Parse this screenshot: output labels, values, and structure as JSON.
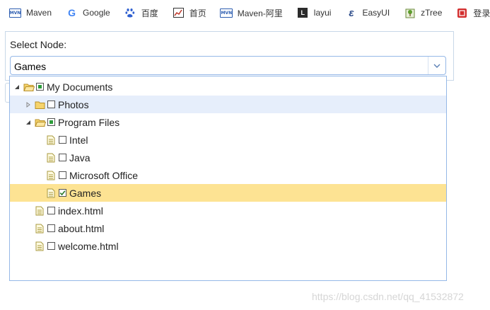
{
  "bookmarks": [
    {
      "label": "Maven",
      "icon": "maven-icon"
    },
    {
      "label": "Google",
      "icon": "google-icon"
    },
    {
      "label": "百度",
      "icon": "baidu-paw-icon"
    },
    {
      "label": "首页",
      "icon": "chart-image-icon"
    },
    {
      "label": "Maven-阿里",
      "icon": "maven-icon"
    },
    {
      "label": "layui",
      "icon": "layui-icon"
    },
    {
      "label": "EasyUI",
      "icon": "easyui-icon"
    },
    {
      "label": "zTree",
      "icon": "ztree-icon"
    },
    {
      "label": "登录--仓库",
      "icon": "red-seal-icon"
    }
  ],
  "panel": {
    "label": "Select Node:",
    "combo_value": "Games"
  },
  "tree": {
    "nodes": [
      {
        "label": "My Documents",
        "level": 0,
        "type": "folder",
        "expanded": true,
        "check": "partial"
      },
      {
        "label": "Photos",
        "level": 1,
        "type": "folder",
        "expanded": false,
        "check": "none",
        "state": "hover"
      },
      {
        "label": "Program Files",
        "level": 1,
        "type": "folder",
        "expanded": true,
        "check": "partial"
      },
      {
        "label": "Intel",
        "level": 2,
        "type": "file",
        "check": "none"
      },
      {
        "label": "Java",
        "level": 2,
        "type": "file",
        "check": "none"
      },
      {
        "label": "Microsoft Office",
        "level": 2,
        "type": "file",
        "check": "none"
      },
      {
        "label": "Games",
        "level": 2,
        "type": "file",
        "check": "checked",
        "state": "selected"
      },
      {
        "label": "index.html",
        "level": 1,
        "type": "file",
        "check": "none"
      },
      {
        "label": "about.html",
        "level": 1,
        "type": "file",
        "check": "none"
      },
      {
        "label": "welcome.html",
        "level": 1,
        "type": "file",
        "check": "none"
      }
    ]
  },
  "watermark": "https://blog.csdn.net/qq_41532872",
  "colors": {
    "combo_border": "#95b8e7",
    "hover_row": "#e6eefb",
    "selected_row": "#fde393",
    "partial_check": "#2e9d3b",
    "folder_fill": "#f6d36b"
  }
}
